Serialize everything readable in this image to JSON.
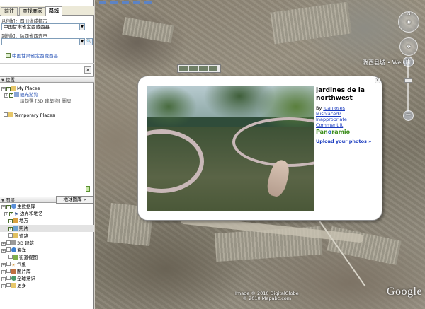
{
  "sidebar": {
    "tabs": [
      {
        "label": "前往"
      },
      {
        "label": "查找商家"
      },
      {
        "label": "路线"
      }
    ],
    "from_hint": "从例如：四川省成都市",
    "from_value": "中国甘肃省定西陇西县",
    "to_hint": "到例如：陕西省西安市",
    "to_value": "",
    "result_item": "中国甘肃省定西陇西县",
    "places_header": "位置",
    "places": {
      "my_places": "My Places",
      "sightseeing": "観光游覧",
      "sightseeing_note": "請勾選 [3D 建築物] 圖層",
      "temporary": "Temporary Places"
    },
    "layers_header": "图层",
    "gallery_button": "地球图库 »",
    "layers": [
      {
        "label": "主数据库",
        "checked": true
      },
      {
        "label": "边界和地名",
        "checked": true
      },
      {
        "label": "地方",
        "checked": true
      },
      {
        "label": "照片",
        "checked": true
      },
      {
        "label": "道路",
        "checked": false
      },
      {
        "label": "3D 建筑",
        "checked": false
      },
      {
        "label": "海洋",
        "checked": false
      },
      {
        "label": "街道视图",
        "checked": false
      },
      {
        "label": "气象",
        "checked": false
      },
      {
        "label": "图片库",
        "checked": false
      },
      {
        "label": "全球意识",
        "checked": false
      },
      {
        "label": "更多",
        "checked": false
      }
    ]
  },
  "map": {
    "place_label": "陇西县城 • Weishui",
    "copyright_line1": "Image © 2010 DigitalGlobe",
    "copyright_line2": "© 2010 Mapabc.com",
    "logo": "Google"
  },
  "balloon": {
    "title": "jardines de la northwest",
    "by_prefix": "By ",
    "author": "juanjoses",
    "misplaced": "Misplaced?",
    "inappropriate": "Inappropriate",
    "comment": "Comment it",
    "brand_pan": "Pan",
    "brand_o": "o",
    "brand_ramio": "ramio",
    "upload": "Upload your photos »",
    "close": "×"
  },
  "colors": {
    "link": "#1a3bbf",
    "panoramio_green": "#3f8f1e",
    "sidebar_link": "#2451b6"
  },
  "icons": {
    "zoom_in": "plus-icon",
    "zoom_out": "minus-icon",
    "compass": "compass-icon",
    "look": "eye-icon",
    "move": "hand-icon"
  }
}
